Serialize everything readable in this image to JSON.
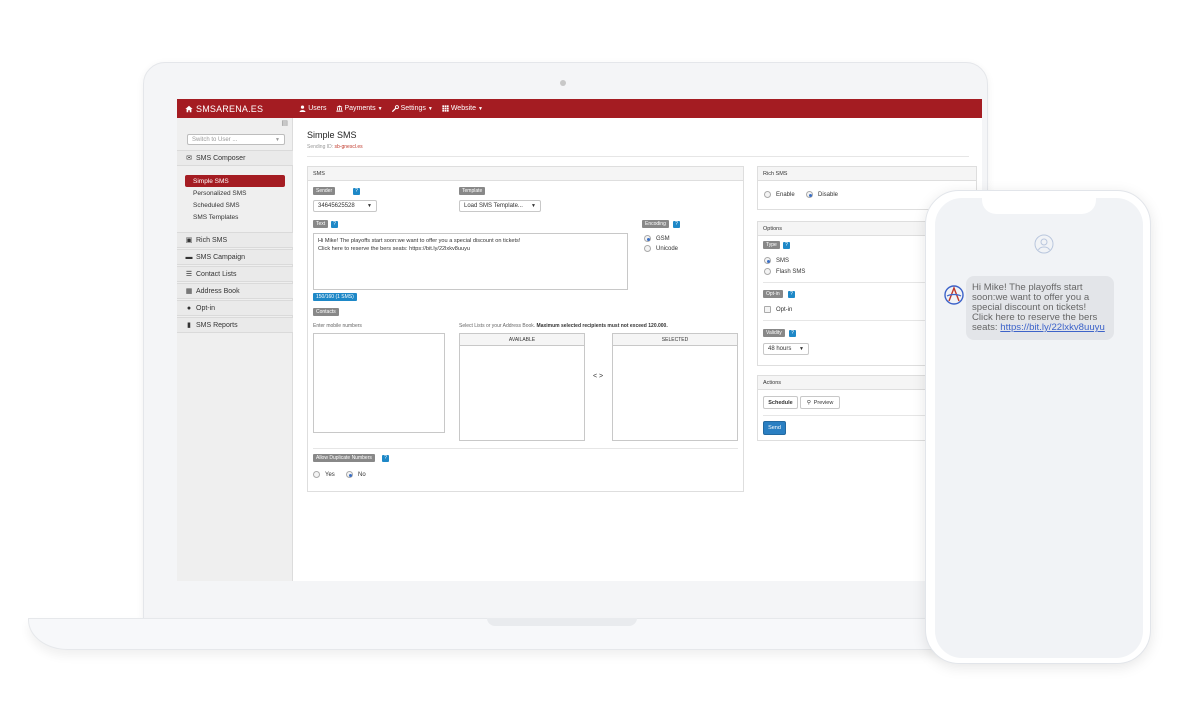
{
  "navbar": {
    "brand": "SMSARENA.ES",
    "menu": [
      {
        "label": "Users",
        "icon": "user-icon",
        "caret": false
      },
      {
        "label": "Payments",
        "icon": "bank-icon",
        "caret": true
      },
      {
        "label": "Settings",
        "icon": "wrench-icon",
        "caret": true
      },
      {
        "label": "Website",
        "icon": "grid-icon",
        "caret": true
      }
    ]
  },
  "sidebar": {
    "switch_user": "Switch to User ...",
    "composer": "SMS Composer",
    "composer_items": [
      "Simple SMS",
      "Personalized SMS",
      "Scheduled SMS",
      "SMS Templates"
    ],
    "active_item": "Simple SMS",
    "sections": [
      "Rich SMS",
      "SMS Campaign",
      "Contact Lists",
      "Address Book",
      "Opt-in",
      "SMS Reports"
    ]
  },
  "page": {
    "title": "Simple SMS",
    "sending_id_label": "Sending ID:",
    "sending_id_value": "sb-gnescl.es"
  },
  "sms_panel": {
    "heading": "SMS",
    "sender_label": "Sender",
    "sender_value": "34645625528",
    "template_label": "Template",
    "template_value": "Load SMS Template...",
    "text_label": "Text",
    "text_line1": "Hi Mike! The playoffs start soon:we want to offer you a special discount on tickets!",
    "text_line2": "Click here to reserve the bers seats: https://bit.ly/22lxkv8uuyu",
    "counter": "150/160 (1 SMS)",
    "encoding_label": "Encoding",
    "encoding_options": [
      "GSM",
      "Unicode"
    ],
    "encoding_selected": "GSM",
    "contacts_label": "Contacts",
    "enter_numbers": "Enter mobile numbers",
    "select_lists": "Select Lists or your Address Book.",
    "max_note": "Maximum selected recipients must not exceed 120.000.",
    "available": "AVAILABLE",
    "selected": "SELECTED",
    "transfer": "< >",
    "duplicates_label": "Allow Duplicate Numbers",
    "duplicates_options": [
      "Yes",
      "No"
    ],
    "duplicates_selected": "No"
  },
  "rich_panel": {
    "heading": "Rich SMS",
    "options": [
      "Enable",
      "Disable"
    ],
    "selected": "Disable"
  },
  "options_panel": {
    "heading": "Options",
    "type_label": "Type",
    "type_options": [
      "SMS",
      "Flash SMS"
    ],
    "type_selected": "SMS",
    "optin_label": "Opt-in",
    "optin_option": "Opt-in",
    "validity_label": "Validity",
    "validity_value": "48 hours"
  },
  "actions_panel": {
    "heading": "Actions",
    "schedule": "Schedule",
    "preview": "Preview",
    "send": "Send"
  },
  "phone": {
    "message": "Hi Mike! The playoffs start soon:we want to offer you a special discount on tickets! Click here to reserve the bers seats:",
    "link": "https://bit.ly/22lxkv8uuyu"
  },
  "help_glyph": "?",
  "colors": {
    "brand_red": "#a41c22",
    "info_blue": "#1e88c7",
    "primary_button": "#2a7fc2",
    "link_blue": "#3d63c9"
  }
}
